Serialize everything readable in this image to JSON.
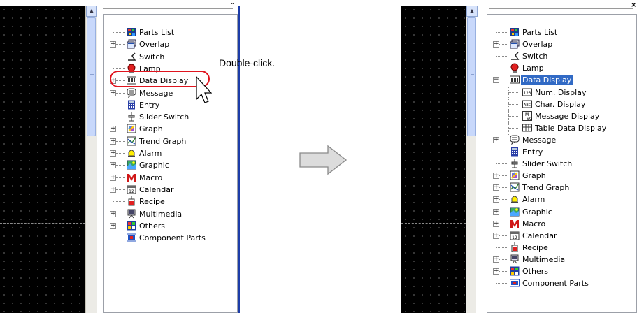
{
  "left_tree": {
    "items": [
      {
        "label": "Parts List",
        "icon": "parts-list-icon",
        "expander": "none"
      },
      {
        "label": "Overlap",
        "icon": "overlap-icon",
        "expander": "plus"
      },
      {
        "label": "Switch",
        "icon": "switch-icon",
        "expander": "none"
      },
      {
        "label": "Lamp",
        "icon": "lamp-icon",
        "expander": "none"
      },
      {
        "label": "Data Display",
        "icon": "data-display-icon",
        "expander": "plus"
      },
      {
        "label": "Message",
        "icon": "message-icon",
        "expander": "plus"
      },
      {
        "label": "Entry",
        "icon": "entry-icon",
        "expander": "none"
      },
      {
        "label": "Slider Switch",
        "icon": "slider-switch-icon",
        "expander": "none"
      },
      {
        "label": "Graph",
        "icon": "graph-icon",
        "expander": "plus"
      },
      {
        "label": "Trend Graph",
        "icon": "trend-graph-icon",
        "expander": "plus"
      },
      {
        "label": "Alarm",
        "icon": "alarm-icon",
        "expander": "plus"
      },
      {
        "label": "Graphic",
        "icon": "graphic-icon",
        "expander": "plus"
      },
      {
        "label": "Macro",
        "icon": "macro-icon",
        "expander": "plus"
      },
      {
        "label": "Calendar",
        "icon": "calendar-icon",
        "expander": "plus"
      },
      {
        "label": "Recipe",
        "icon": "recipe-icon",
        "expander": "none"
      },
      {
        "label": "Multimedia",
        "icon": "multimedia-icon",
        "expander": "plus"
      },
      {
        "label": "Others",
        "icon": "others-icon",
        "expander": "plus"
      },
      {
        "label": "Component Parts",
        "icon": "component-parts-icon",
        "expander": "none"
      }
    ]
  },
  "right_tree": {
    "items": [
      {
        "label": "Parts List",
        "icon": "parts-list-icon",
        "expander": "none",
        "indent": 0
      },
      {
        "label": "Overlap",
        "icon": "overlap-icon",
        "expander": "plus",
        "indent": 0
      },
      {
        "label": "Switch",
        "icon": "switch-icon",
        "expander": "none",
        "indent": 0
      },
      {
        "label": "Lamp",
        "icon": "lamp-icon",
        "expander": "none",
        "indent": 0
      },
      {
        "label": "Data Display",
        "icon": "data-display-icon",
        "expander": "minus",
        "indent": 0,
        "selected": true
      },
      {
        "label": "Num. Display",
        "icon": "num-display-icon",
        "expander": "none",
        "indent": 1
      },
      {
        "label": "Char. Display",
        "icon": "char-display-icon",
        "expander": "none",
        "indent": 1
      },
      {
        "label": "Message Display",
        "icon": "message-display-icon",
        "expander": "none",
        "indent": 1
      },
      {
        "label": "Table Data Display",
        "icon": "table-data-display-icon",
        "expander": "none",
        "indent": 1
      },
      {
        "label": "Message",
        "icon": "message-icon",
        "expander": "plus",
        "indent": 0
      },
      {
        "label": "Entry",
        "icon": "entry-icon",
        "expander": "none",
        "indent": 0
      },
      {
        "label": "Slider Switch",
        "icon": "slider-switch-icon",
        "expander": "none",
        "indent": 0
      },
      {
        "label": "Graph",
        "icon": "graph-icon",
        "expander": "plus",
        "indent": 0
      },
      {
        "label": "Trend Graph",
        "icon": "trend-graph-icon",
        "expander": "plus",
        "indent": 0
      },
      {
        "label": "Alarm",
        "icon": "alarm-icon",
        "expander": "plus",
        "indent": 0
      },
      {
        "label": "Graphic",
        "icon": "graphic-icon",
        "expander": "plus",
        "indent": 0
      },
      {
        "label": "Macro",
        "icon": "macro-icon",
        "expander": "plus",
        "indent": 0
      },
      {
        "label": "Calendar",
        "icon": "calendar-icon",
        "expander": "plus",
        "indent": 0
      },
      {
        "label": "Recipe",
        "icon": "recipe-icon",
        "expander": "none",
        "indent": 0
      },
      {
        "label": "Multimedia",
        "icon": "multimedia-icon",
        "expander": "plus",
        "indent": 0
      },
      {
        "label": "Others",
        "icon": "others-icon",
        "expander": "plus",
        "indent": 0
      },
      {
        "label": "Component Parts",
        "icon": "component-parts-icon",
        "expander": "none",
        "indent": 0
      }
    ]
  },
  "annotation": {
    "text": "Double-click."
  },
  "colors": {
    "highlight": "#e0141e",
    "selection": "#316ac5",
    "canvas": "#000000"
  }
}
